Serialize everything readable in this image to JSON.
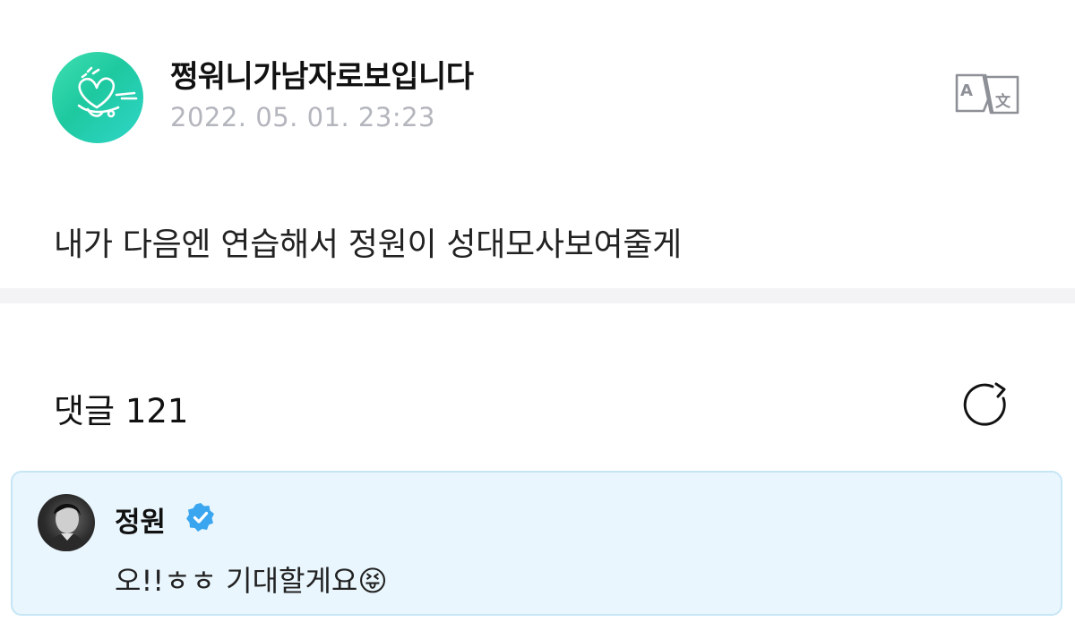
{
  "post": {
    "author_name": "쩡워니가남자로보입니다",
    "date": "2022. 05. 01. 23:23",
    "body": "내가 다음엔 연습해서 정원이 성대모사보여줄게",
    "avatar_icon": "heart-doodle-icon",
    "translate_icon": "translate-icon"
  },
  "comments": {
    "title": "댓글 121",
    "refresh_icon": "refresh-icon",
    "items": [
      {
        "author": "정원",
        "verified": true,
        "verified_icon": "verified-check-icon",
        "text": "오!!ㅎㅎ 기대할게요😝",
        "highlight_color": "#eaf6fd"
      }
    ]
  },
  "colors": {
    "accent": "#3ba6f0",
    "avatar_gradient_start": "#3fe0b0",
    "date_gray": "#b4b6bd",
    "divider": "#f3f3f6"
  }
}
